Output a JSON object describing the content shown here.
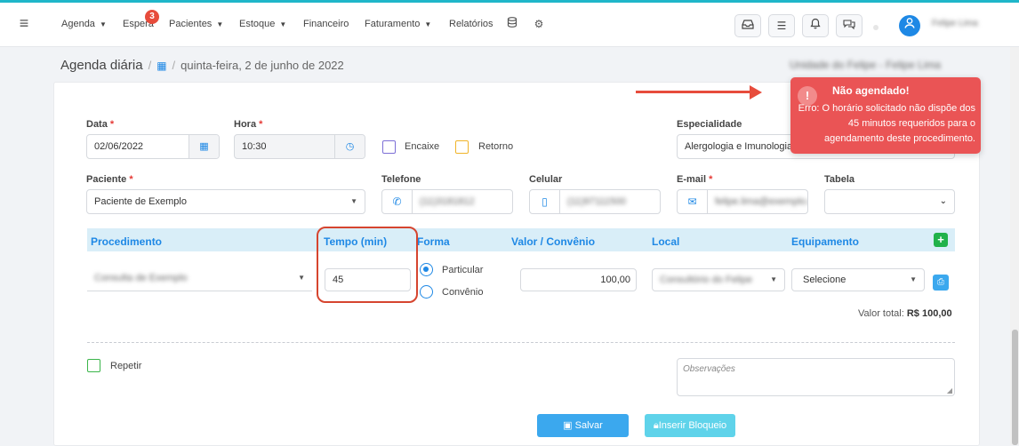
{
  "nav": {
    "items": [
      {
        "label": "Agenda",
        "has_caret": true
      },
      {
        "label": "Espera",
        "badge": "3"
      },
      {
        "label": "Pacientes",
        "has_caret": true
      },
      {
        "label": "Estoque",
        "has_caret": true
      },
      {
        "label": "Financeiro"
      },
      {
        "label": "Faturamento",
        "has_caret": true
      },
      {
        "label": "Relatórios"
      }
    ],
    "icons": [
      "database-icon",
      "settings-icon"
    ],
    "tool_icons": [
      "inbox-icon",
      "checklist-icon",
      "bell-icon",
      "chat-icon"
    ],
    "user_name": "Felipe Lima"
  },
  "header": {
    "title": "Agenda diária",
    "date": "quinta-feira, 2 de junho de 2022",
    "unit": "Unidade do Felipe - Felipe Lima"
  },
  "form": {
    "data": {
      "label": "Data",
      "value": "02/06/2022"
    },
    "hora": {
      "label": "Hora",
      "value": "10:30"
    },
    "encaixe_label": "Encaixe",
    "retorno_label": "Retorno",
    "especialidade": {
      "label": "Especialidade",
      "value": "Alergologia e Imunologia"
    },
    "paciente": {
      "label": "Paciente",
      "value": "Paciente de Exemplo"
    },
    "telefone": {
      "label": "Telefone",
      "value": "(11)3181812"
    },
    "celular": {
      "label": "Celular",
      "value": "(11)97111500"
    },
    "email": {
      "label": "E-mail",
      "value": "felipe.lima@exemplo.com"
    },
    "tabela": {
      "label": "Tabela",
      "value": ""
    }
  },
  "procedures": {
    "headers": {
      "procedimento": "Procedimento",
      "tempo": "Tempo (min)",
      "forma": "Forma",
      "valor": "Valor / Convênio",
      "local": "Local",
      "equipamento": "Equipamento"
    },
    "row": {
      "procedimento": "Consulta de Exemplo",
      "tempo": "45",
      "forma_options": [
        "Particular",
        "Convênio"
      ],
      "forma_selected": "Particular",
      "valor": "100,00",
      "local": "Consultório do Felipe",
      "equipamento": "Selecione"
    },
    "total_label": "Valor total:",
    "total_value": "R$ 100,00"
  },
  "repetir_label": "Repetir",
  "observacoes_placeholder": "Observações",
  "buttons": {
    "save": "Salvar",
    "block": "Inserir Bloqueio"
  },
  "toast": {
    "title": "Não agendado!",
    "message": "Erro: O horário solicitado não dispõe dos 45 minutos requeridos para o agendamento deste procedimento."
  },
  "colors": {
    "accent": "#1e88e5",
    "toast_bg": "#ea5455",
    "annotation": "#d6452f",
    "header_strip": "#d9eef8"
  }
}
